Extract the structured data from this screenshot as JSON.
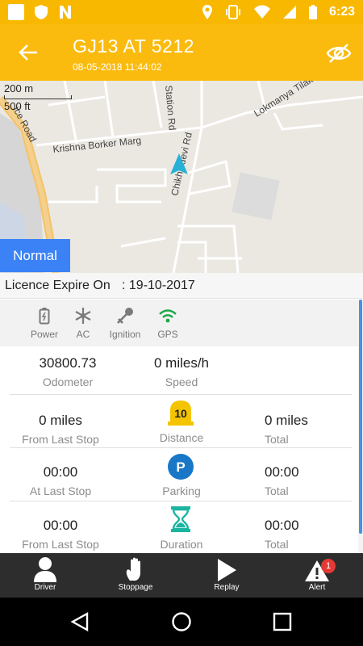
{
  "status_bar": {
    "time": "6:23"
  },
  "app_bar": {
    "title": "GJ13 AT 5212",
    "subtitle": "08-05-2018 11:44:02"
  },
  "map": {
    "scale_metric": "200 m",
    "scale_imperial": "500 ft",
    "streets": [
      "Krishna Borker Marg",
      "Station Rd",
      "Chikhli devi Rd",
      "Lokmanya Tilak Path",
      "ice Road"
    ],
    "mode_button": "Normal"
  },
  "licence": {
    "label": "Licence Expire On",
    "value": ": 19-10-2017"
  },
  "sensors": [
    {
      "label": "Power",
      "icon": "battery-icon"
    },
    {
      "label": "AC",
      "icon": "snowflake-icon"
    },
    {
      "label": "Ignition",
      "icon": "key-icon"
    },
    {
      "label": "GPS",
      "icon": "wifi-signal-icon"
    }
  ],
  "stats": {
    "odometer": {
      "value": "30800.73",
      "label": "Odometer"
    },
    "speed": {
      "value": "0 miles/h",
      "label": "Speed"
    },
    "distance": {
      "left_value": "0 miles",
      "left_label": "From Last Stop",
      "center_label": "Distance",
      "icon_text": "10",
      "right_value": "0 miles",
      "right_label": "Total"
    },
    "parking": {
      "left_value": "00:00",
      "left_label": "At Last Stop",
      "center_label": "Parking",
      "icon_text": "P",
      "right_value": "00:00",
      "right_label": "Total"
    },
    "duration": {
      "left_value": "00:00",
      "left_label": "From Last Stop",
      "center_label": "Duration",
      "right_value": "00:00",
      "right_label": "Total"
    }
  },
  "bottom_nav": [
    {
      "label": "Driver"
    },
    {
      "label": "Stoppage"
    },
    {
      "label": "Replay"
    },
    {
      "label": "Alert",
      "badge": "1"
    }
  ],
  "colors": {
    "accent": "#fbbb0e",
    "button_blue": "#3b82f6",
    "gps_green": "#1ea84a",
    "teal": "#1bb5a0"
  }
}
